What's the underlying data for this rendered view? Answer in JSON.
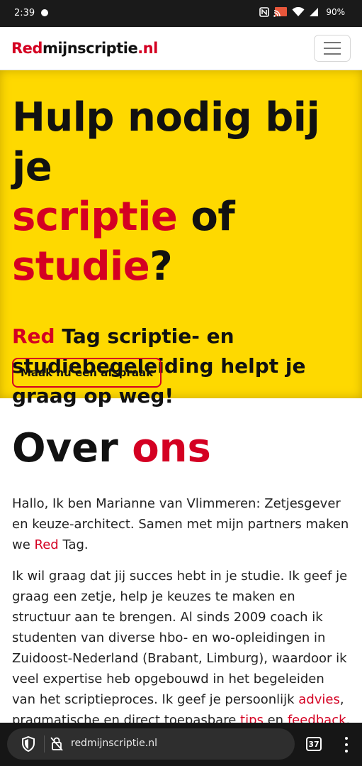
{
  "status_bar": {
    "time": "2:39",
    "battery": "90%",
    "icons": [
      "nfc-icon",
      "cast-icon",
      "wifi-icon",
      "signal-icon"
    ]
  },
  "site": {
    "logo_red": "Red",
    "logo_black": "mijnscriptie",
    "logo_suffix": ".nl",
    "menu_icon": "hamburger-menu-icon"
  },
  "hero": {
    "title_line1": "Hulp nodig bij je",
    "title_red1": "scriptie",
    "title_mid": " of",
    "title_red2": "studie",
    "title_end": "?",
    "subtitle_red": "Red",
    "subtitle_rest": " Tag scriptie- en studiebegeleiding helpt je graag op weg!",
    "cta_label": "Maak nu een afspraak"
  },
  "about": {
    "heading_black": "Over ",
    "heading_red": "ons",
    "p1_before": "Hallo, Ik ben Marianne van Vlimmeren: Zetjesgever en keuze-architect. Samen met mijn partners maken we ",
    "p1_link": "Red",
    "p1_after": " Tag.",
    "p2_before": "Ik wil graag dat jij succes hebt in je studie. Ik geef je graag een zetje, help je keuzes te maken en structuur aan te brengen. Al sinds 2009 coach ik studenten van diverse hbo- en wo-opleidingen in Zuidoost-Nederland (Brabant, Limburg), waardoor ik veel expertise heb opgebouwd in het begeleiden van het scriptieproces. Ik geef je persoonlijk ",
    "p2_link1": "advies",
    "p2_mid": ", pragmatische en direct toepasbare ",
    "p2_link2": "tips",
    "p2_mid2": " en ",
    "p2_link3": "feedback",
    "p2_after": "."
  },
  "browser": {
    "url": "redmijnscriptie.nl",
    "tab_count": "37"
  },
  "colors": {
    "brand_red": "#d40022",
    "hero_yellow": "#fed900"
  }
}
